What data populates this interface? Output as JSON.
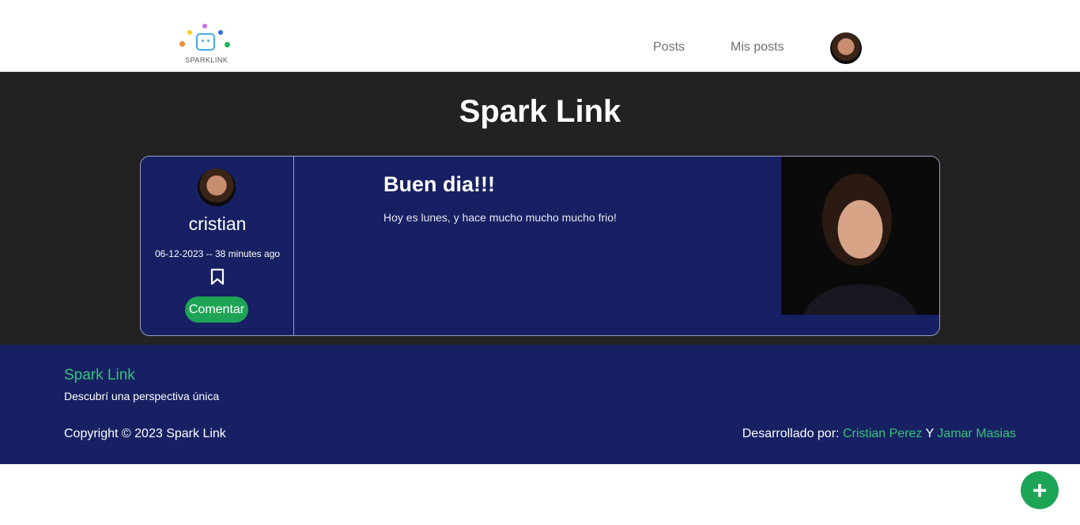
{
  "nav": {
    "logo_text": "SPARKLINK",
    "links": [
      {
        "label": "Posts"
      },
      {
        "label": "Mis posts"
      }
    ],
    "avatar_icon": "user-avatar"
  },
  "hero": {
    "title": "Spark Link"
  },
  "post": {
    "username": "cristian",
    "date": "06-12-2023 -- 38 minutes ago",
    "bookmark_icon": "bookmark-icon",
    "comment_label": "Comentar",
    "title": "Buen dia!!!",
    "body": "Hoy es lunes, y hace mucho mucho mucho frio!"
  },
  "footer": {
    "brand": "Spark Link",
    "tagline": "Descubrí una perspectiva única",
    "copyright": "Copyright © 2023 Spark Link",
    "dev_prefix": "Desarrollado por:",
    "dev1": "Cristian Perez",
    "dev_join": "Y",
    "dev2": "Jamar Masias"
  },
  "fab": {
    "label": "+",
    "icon": "plus-icon"
  },
  "colors": {
    "accent_green": "#1ea456",
    "navy": "#172062",
    "dark": "#222222"
  }
}
